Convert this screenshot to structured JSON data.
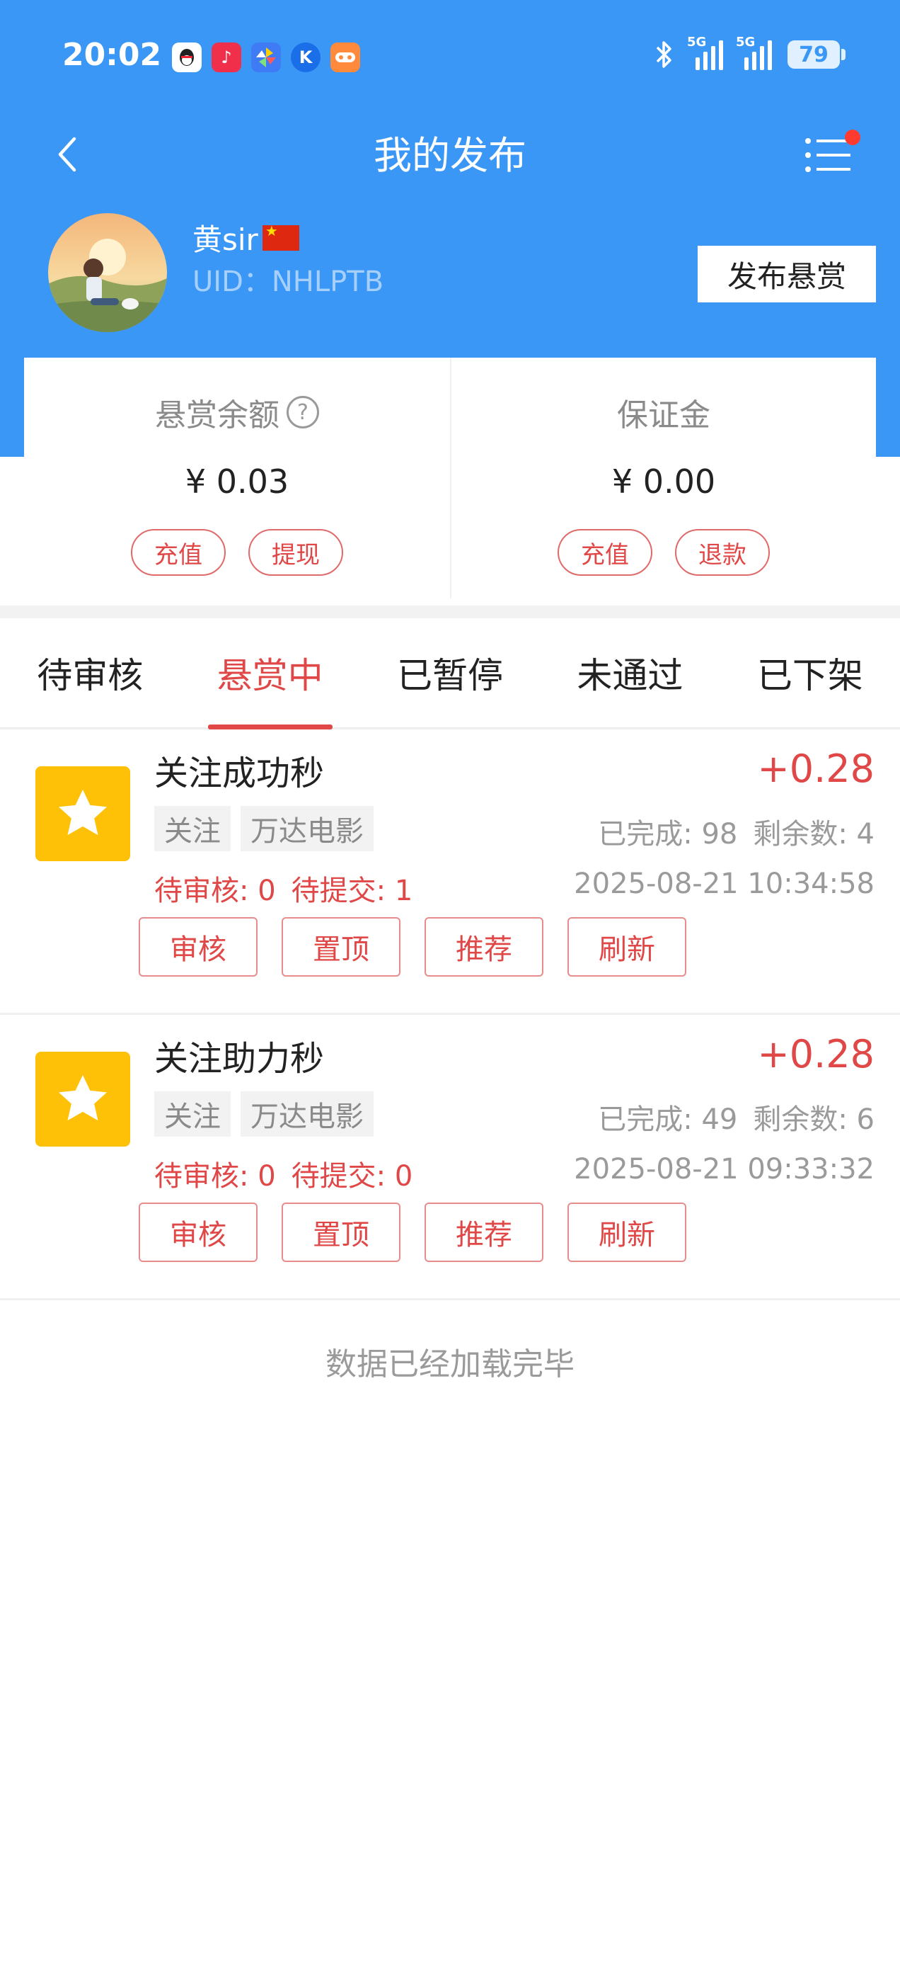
{
  "status_bar": {
    "time": "20:02",
    "battery": "79",
    "network_label": "5G",
    "apps": [
      {
        "icon": "qq-icon",
        "color": "#222222"
      },
      {
        "icon": "music-icon",
        "color": "#f0304a"
      },
      {
        "icon": "pinwheel-icon",
        "color": "#3f7bf5"
      },
      {
        "icon": "k-app-icon",
        "color": "#1a6ee8"
      },
      {
        "icon": "game-icon",
        "color": "#ff8a3c"
      }
    ]
  },
  "nav": {
    "title": "我的发布",
    "back_icon": "chevron-left-icon",
    "menu_icon": "list-menu-icon"
  },
  "profile": {
    "name": "黄sir",
    "uid": "UID：NHLPTB",
    "publish_button": "发布悬赏"
  },
  "balance": {
    "reward": {
      "label": "悬赏余额",
      "amount": "¥ 0.03",
      "btn1": "充值",
      "btn2": "提现"
    },
    "deposit": {
      "label": "保证金",
      "amount": "¥ 0.00",
      "btn1": "充值",
      "btn2": "退款"
    }
  },
  "tabs": [
    {
      "label": "待审核"
    },
    {
      "label": "悬赏中",
      "active": true
    },
    {
      "label": "已暂停"
    },
    {
      "label": "未通过"
    },
    {
      "label": "已下架"
    }
  ],
  "items": [
    {
      "title": "关注成功秒",
      "price": "+0.28",
      "tags": [
        "关注",
        "万达电影"
      ],
      "completed": "已完成: 98",
      "remaining": "剩余数: 4",
      "pending_review": "待审核: 0",
      "pending_submit": "待提交: 1",
      "date": "2025-08-21 10:34:58",
      "actions": [
        "审核",
        "置顶",
        "推荐",
        "刷新"
      ]
    },
    {
      "title": "关注助力秒",
      "price": "+0.28",
      "tags": [
        "关注",
        "万达电影"
      ],
      "completed": "已完成: 49",
      "remaining": "剩余数: 6",
      "pending_review": "待审核: 0",
      "pending_submit": "待提交: 0",
      "date": "2025-08-21 09:33:32",
      "actions": [
        "审核",
        "置顶",
        "推荐",
        "刷新"
      ]
    }
  ],
  "footer": "数据已经加载完毕",
  "colors": {
    "header_blue": "#3a97f5",
    "accent_red": "#e04848",
    "star_yellow": "#ffc107"
  }
}
